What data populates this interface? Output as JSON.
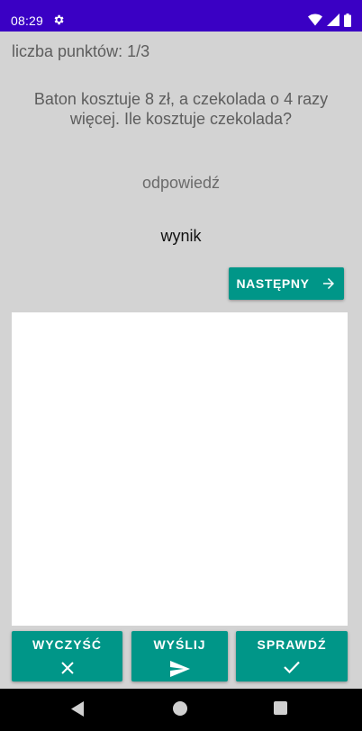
{
  "status_bar": {
    "time": "08:29",
    "icons": [
      "gear-icon",
      "wifi-icon",
      "signal-icon",
      "battery-icon"
    ],
    "background": "#3a00c4"
  },
  "quiz": {
    "score_text": "liczba punktów: 1/3",
    "question": "Baton kosztuje 8 zł, a czekolada o 4 razy więcej. Ile kosztuje czekolada?",
    "answer_placeholder": "odpowiedź",
    "result_label": "wynik",
    "next_button": {
      "label": "NASTĘPNY",
      "icon": "arrow-right-icon"
    }
  },
  "actions": {
    "clear": {
      "label": "WYCZYŚĆ",
      "icon": "close-icon"
    },
    "send": {
      "label": "WYŚLIJ",
      "icon": "send-icon"
    },
    "check": {
      "label": "SPRAWDŹ",
      "icon": "check-icon"
    }
  },
  "navigation": {
    "icons": [
      "back-icon",
      "home-icon",
      "recent-apps-icon"
    ]
  },
  "colors": {
    "accent": "#009688",
    "app_background": "#d3d3d3",
    "drawing_area": "#ffffff"
  }
}
